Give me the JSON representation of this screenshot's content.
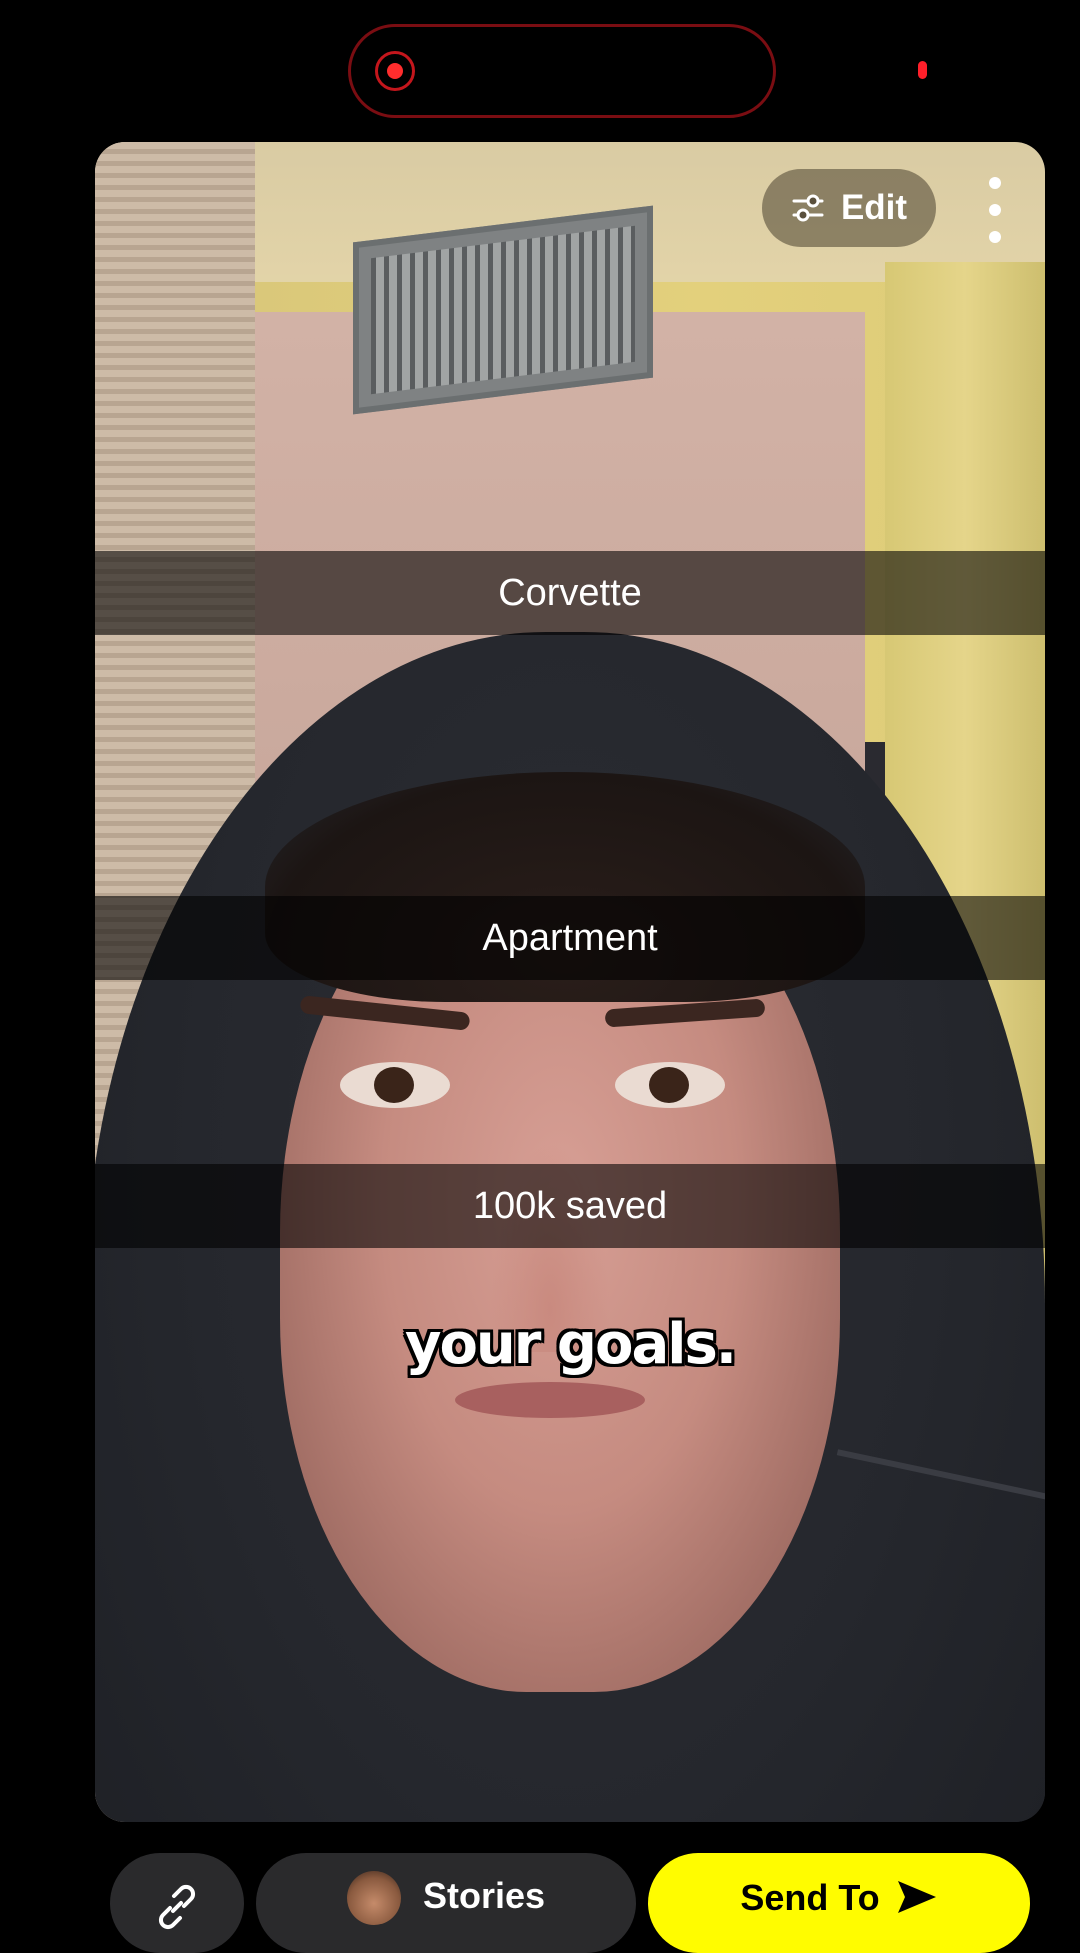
{
  "camera_overlay": {
    "recording_indicator": "record-dot-icon",
    "mic_indicator": "mic-in-use-indicator"
  },
  "preview": {
    "edit_button": {
      "label": "Edit",
      "icon": "sliders-icon"
    },
    "more_button": {
      "icon": "more-vertical-icon"
    },
    "captions": [
      "Corvette",
      "Apartment",
      "100k saved"
    ],
    "subtitle": "your goals."
  },
  "bottom_bar": {
    "link_button": {
      "icon": "link-icon"
    },
    "stories_button": {
      "label": "Stories",
      "icon": "bitmoji-avatar"
    },
    "send_to_button": {
      "label": "Send To",
      "icon": "send-arrow-icon"
    }
  },
  "colors": {
    "snap_yellow": "#FFFC00",
    "record_red": "#FF2D2D",
    "background": "#000000"
  }
}
